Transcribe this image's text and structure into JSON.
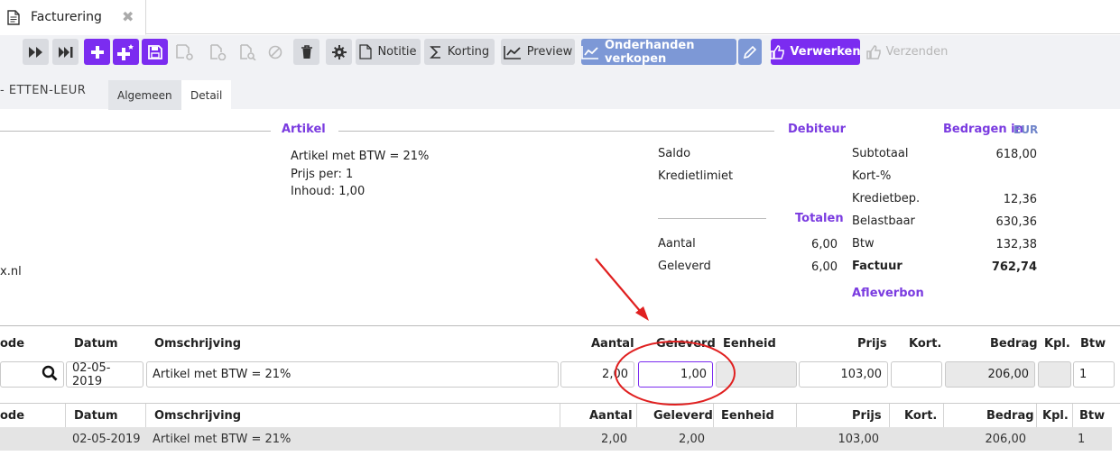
{
  "tab": {
    "title": "Facturering",
    "close": "✖"
  },
  "toolbar": {
    "notitie": "Notitie",
    "korting": "Korting",
    "preview": "Preview",
    "onderhanden": "Onderhanden verkopen",
    "verwerken": "Verwerken",
    "verzenden": "Verzenden"
  },
  "subbar": {
    "name": "- ETTEN-LEUR",
    "tabs": [
      "Algemeen",
      "Detail"
    ]
  },
  "artikel": {
    "title": "Artikel",
    "line1": "Artikel met BTW = 21%",
    "line2": "Prijs per: 1",
    "line3": "Inhoud: 1,00",
    "partial_left": "x.nl"
  },
  "debiteur": {
    "title": "Debiteur",
    "saldo": "Saldo",
    "kredietlimiet": "Kredietlimiet"
  },
  "totalen": {
    "title": "Totalen",
    "aantal_label": "Aantal",
    "aantal_value": "6,00",
    "geleverd_label": "Geleverd",
    "geleverd_value": "6,00"
  },
  "bedragen": {
    "title": "Bedragen in",
    "currency": "EUR",
    "subtotaal_label": "Subtotaal",
    "subtotaal_value": "618,00",
    "kort_label": "Kort-%",
    "kredietbep_label": "Kredietbep.",
    "kredietbep_value": "12,36",
    "belastbaar_label": "Belastbaar",
    "belastbaar_value": "630,36",
    "btw_label": "Btw",
    "btw_value": "132,38",
    "factuur_label": "Factuur",
    "factuur_value": "762,74",
    "afleverbon": "Afleverbon"
  },
  "columns": {
    "code": "ode",
    "datum": "Datum",
    "omschrijving": "Omschrijving",
    "aantal": "Aantal",
    "geleverd": "Geleverd",
    "eenheid": "Eenheid",
    "prijs": "Prijs",
    "kort": "Kort.",
    "bedrag": "Bedrag",
    "kpl": "Kpl.",
    "btw": "Btw"
  },
  "entry": {
    "datum": "02-05-2019",
    "omschrijving": "Artikel met BTW = 21%",
    "aantal": "2,00",
    "geleverd": "1,00",
    "prijs": "103,00",
    "bedrag": "206,00",
    "btw": "1"
  },
  "rows": [
    {
      "datum": "02-05-2019",
      "omschrijving": "Artikel met BTW = 21%",
      "aantal": "2,00",
      "geleverd": "2,00",
      "prijs": "103,00",
      "bedrag": "206,00",
      "btw": "1"
    }
  ],
  "colors": {
    "purple": "#7b2cf0",
    "blue": "#7d98d6",
    "annotation_red": "#e02020"
  }
}
